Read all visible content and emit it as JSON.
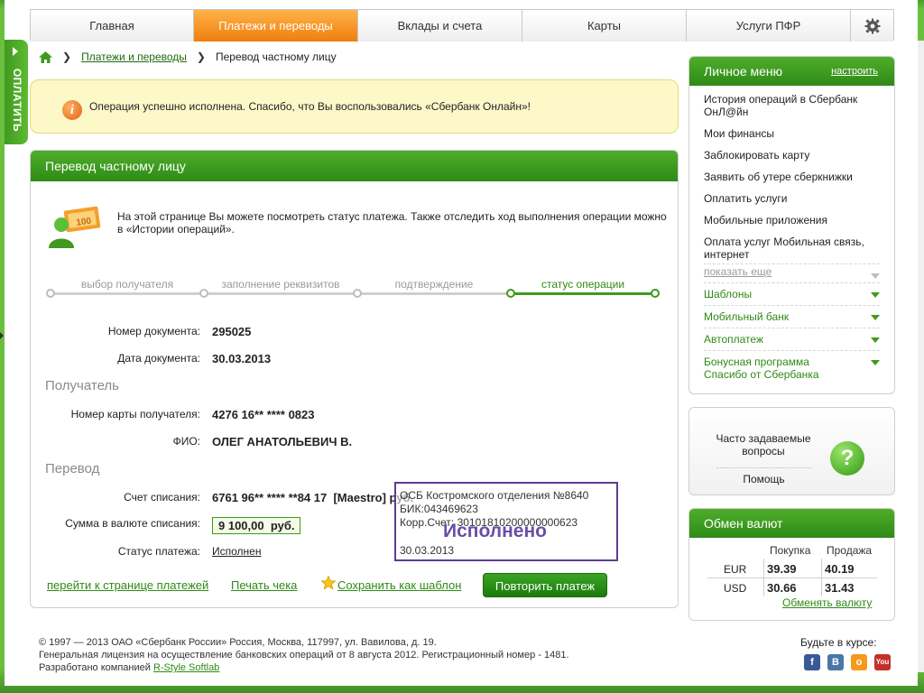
{
  "pay_tab": {
    "label": "ОПЛАТИТЬ"
  },
  "nav": {
    "tabs": [
      "Главная",
      "Платежи и переводы",
      "Вклады и счета",
      "Карты",
      "Услуги ПФР"
    ],
    "active": "Платежи и переводы",
    "settings_icon": "gear-icon"
  },
  "breadcrumb": {
    "home_icon": "home-icon",
    "link": "Платежи и переводы",
    "current": "Перевод частному лицу"
  },
  "notice": {
    "text": "Операция успешно исполнена. Спасибо, что Вы воспользовались «Сбербанк Онлайн»!"
  },
  "panel": {
    "title": "Перевод частному лицу",
    "intro": "На этой странице Вы можете посмотреть статус платежа. Также отследить ход выполнения операции можно в «Истории операций».",
    "steps": [
      "выбор получателя",
      "заполнение реквизитов",
      "подтверждение",
      "статус операции"
    ],
    "active_step": "статус операции",
    "doc_number_label": "Номер документа:",
    "doc_number": "295025",
    "doc_date_label": "Дата документа:",
    "doc_date": "30.03.2013",
    "recipient_section": "Получатель",
    "card_label": "Номер карты получателя:",
    "card": "4276 16** **** 0823",
    "fio_label": "ФИО:",
    "fio": "ОЛЕГ АНАТОЛЬЕВИЧ В.",
    "transfer_section": "Перевод",
    "account_label": "Счет списания:",
    "account": "6761 96** **** **84 17  [Maestro] руб.",
    "amount_label": "Сумма в валюте списания:",
    "amount": "9 100,00  руб.",
    "status_label": "Статус платежа:",
    "status": "Исполнен"
  },
  "stamp": {
    "line1": "ОСБ Костромского отделения №8640",
    "line2": "БИК:043469623",
    "line3": "Корр.Счет: 30101810200000000623",
    "big": "Исполнено",
    "date": "30.03.2013"
  },
  "actions": {
    "to_payments": "перейти к странице платежей",
    "print": "Печать чека",
    "save_template": "Сохранить как шаблон",
    "repeat": "Повторить платеж"
  },
  "menu": {
    "title": "Личное меню",
    "configure": "настроить",
    "items": [
      "История операций в Сбербанк ОнЛ@йн",
      "Мои финансы",
      "Заблокировать карту",
      "Заявить об утере сберкнижки",
      "Оплатить услуги",
      "Мобильные приложения",
      "Оплата услуг Мобильная связь, интернет"
    ],
    "more": "показать еще",
    "groups": [
      "Шаблоны",
      "Мобильный банк",
      "Автоплатеж",
      "Бонусная программа Спасибо от Сбербанка"
    ]
  },
  "faq": {
    "question": "Часто задаваемые вопросы",
    "help": "Помощь",
    "icon": "question-icon"
  },
  "fx": {
    "title": "Обмен валют",
    "buy": "Покупка",
    "sell": "Продажа",
    "rows": [
      {
        "cur": "EUR",
        "buy": "39.39",
        "sell": "40.19"
      },
      {
        "cur": "USD",
        "buy": "30.66",
        "sell": "31.43"
      }
    ],
    "exchange_link": "Обменять валюту"
  },
  "footer": {
    "line1": "© 1997 — 2013 ОАО «Сбербанк России» Россия, Москва, 117997, ул. Вавилова, д. 19.",
    "line2": "Генеральная лицензия на осуществление банковских операций от 8 августа 2012. Регистрационный номер - 1481.",
    "line3_prefix": "Разработано компанией ",
    "line3_link": "R-Style Softlab"
  },
  "social": {
    "title": "Будьте в курсе:",
    "icons": [
      "facebook-icon",
      "vk-icon",
      "odnoklassniki-icon",
      "youtube-icon"
    ]
  },
  "colors": {
    "green": "#2f8a17",
    "orange": "#f07d10",
    "notice_bg": "#fdf8c8",
    "stamp": "#6a4ea8"
  }
}
